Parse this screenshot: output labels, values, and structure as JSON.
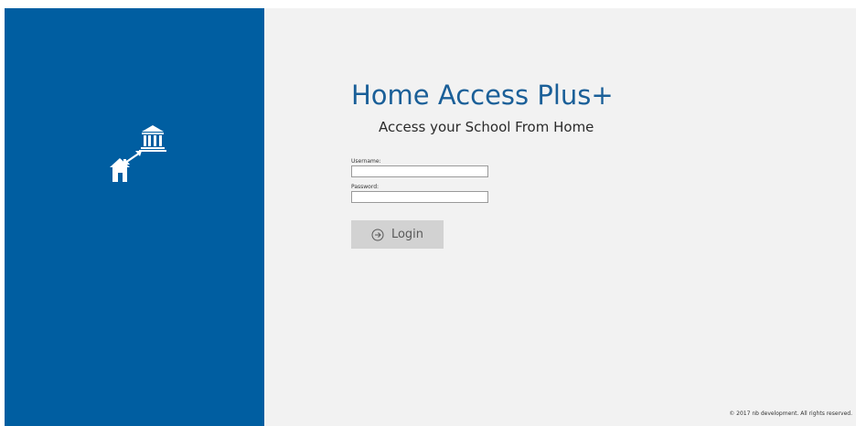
{
  "app": {
    "title": "Home Access Plus+",
    "subtitle": "Access your School From Home",
    "logo_icon": "home-to-school-icon",
    "accent_color": "#005ea1",
    "title_color": "#1a5f98"
  },
  "form": {
    "username_label": "Username:",
    "username_value": "",
    "password_label": "Password:",
    "password_value": "",
    "login_label": "Login",
    "login_icon": "arrow-circle-right-icon"
  },
  "footer": {
    "copyright": "© 2017 nb development. All rights reserved."
  }
}
